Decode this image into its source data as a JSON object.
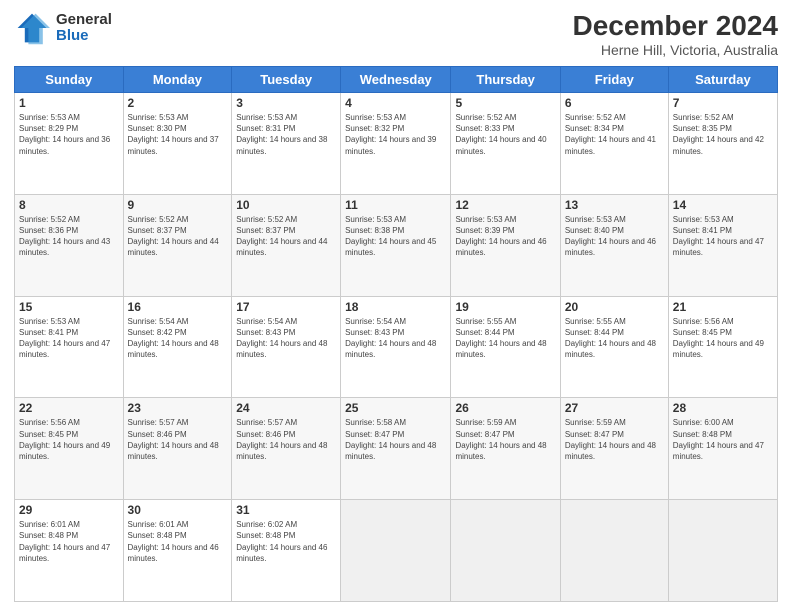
{
  "logo": {
    "general": "General",
    "blue": "Blue"
  },
  "title": "December 2024",
  "subtitle": "Herne Hill, Victoria, Australia",
  "days_of_week": [
    "Sunday",
    "Monday",
    "Tuesday",
    "Wednesday",
    "Thursday",
    "Friday",
    "Saturday"
  ],
  "weeks": [
    [
      {
        "num": "1",
        "rise": "5:53 AM",
        "set": "8:29 PM",
        "daylight": "14 hours and 36 minutes."
      },
      {
        "num": "2",
        "rise": "5:53 AM",
        "set": "8:30 PM",
        "daylight": "14 hours and 37 minutes."
      },
      {
        "num": "3",
        "rise": "5:53 AM",
        "set": "8:31 PM",
        "daylight": "14 hours and 38 minutes."
      },
      {
        "num": "4",
        "rise": "5:53 AM",
        "set": "8:32 PM",
        "daylight": "14 hours and 39 minutes."
      },
      {
        "num": "5",
        "rise": "5:52 AM",
        "set": "8:33 PM",
        "daylight": "14 hours and 40 minutes."
      },
      {
        "num": "6",
        "rise": "5:52 AM",
        "set": "8:34 PM",
        "daylight": "14 hours and 41 minutes."
      },
      {
        "num": "7",
        "rise": "5:52 AM",
        "set": "8:35 PM",
        "daylight": "14 hours and 42 minutes."
      }
    ],
    [
      {
        "num": "8",
        "rise": "5:52 AM",
        "set": "8:36 PM",
        "daylight": "14 hours and 43 minutes."
      },
      {
        "num": "9",
        "rise": "5:52 AM",
        "set": "8:37 PM",
        "daylight": "14 hours and 44 minutes."
      },
      {
        "num": "10",
        "rise": "5:52 AM",
        "set": "8:37 PM",
        "daylight": "14 hours and 44 minutes."
      },
      {
        "num": "11",
        "rise": "5:53 AM",
        "set": "8:38 PM",
        "daylight": "14 hours and 45 minutes."
      },
      {
        "num": "12",
        "rise": "5:53 AM",
        "set": "8:39 PM",
        "daylight": "14 hours and 46 minutes."
      },
      {
        "num": "13",
        "rise": "5:53 AM",
        "set": "8:40 PM",
        "daylight": "14 hours and 46 minutes."
      },
      {
        "num": "14",
        "rise": "5:53 AM",
        "set": "8:41 PM",
        "daylight": "14 hours and 47 minutes."
      }
    ],
    [
      {
        "num": "15",
        "rise": "5:53 AM",
        "set": "8:41 PM",
        "daylight": "14 hours and 47 minutes."
      },
      {
        "num": "16",
        "rise": "5:54 AM",
        "set": "8:42 PM",
        "daylight": "14 hours and 48 minutes."
      },
      {
        "num": "17",
        "rise": "5:54 AM",
        "set": "8:43 PM",
        "daylight": "14 hours and 48 minutes."
      },
      {
        "num": "18",
        "rise": "5:54 AM",
        "set": "8:43 PM",
        "daylight": "14 hours and 48 minutes."
      },
      {
        "num": "19",
        "rise": "5:55 AM",
        "set": "8:44 PM",
        "daylight": "14 hours and 48 minutes."
      },
      {
        "num": "20",
        "rise": "5:55 AM",
        "set": "8:44 PM",
        "daylight": "14 hours and 48 minutes."
      },
      {
        "num": "21",
        "rise": "5:56 AM",
        "set": "8:45 PM",
        "daylight": "14 hours and 49 minutes."
      }
    ],
    [
      {
        "num": "22",
        "rise": "5:56 AM",
        "set": "8:45 PM",
        "daylight": "14 hours and 49 minutes."
      },
      {
        "num": "23",
        "rise": "5:57 AM",
        "set": "8:46 PM",
        "daylight": "14 hours and 48 minutes."
      },
      {
        "num": "24",
        "rise": "5:57 AM",
        "set": "8:46 PM",
        "daylight": "14 hours and 48 minutes."
      },
      {
        "num": "25",
        "rise": "5:58 AM",
        "set": "8:47 PM",
        "daylight": "14 hours and 48 minutes."
      },
      {
        "num": "26",
        "rise": "5:59 AM",
        "set": "8:47 PM",
        "daylight": "14 hours and 48 minutes."
      },
      {
        "num": "27",
        "rise": "5:59 AM",
        "set": "8:47 PM",
        "daylight": "14 hours and 48 minutes."
      },
      {
        "num": "28",
        "rise": "6:00 AM",
        "set": "8:48 PM",
        "daylight": "14 hours and 47 minutes."
      }
    ],
    [
      {
        "num": "29",
        "rise": "6:01 AM",
        "set": "8:48 PM",
        "daylight": "14 hours and 47 minutes."
      },
      {
        "num": "30",
        "rise": "6:01 AM",
        "set": "8:48 PM",
        "daylight": "14 hours and 46 minutes."
      },
      {
        "num": "31",
        "rise": "6:02 AM",
        "set": "8:48 PM",
        "daylight": "14 hours and 46 minutes."
      },
      null,
      null,
      null,
      null
    ]
  ]
}
